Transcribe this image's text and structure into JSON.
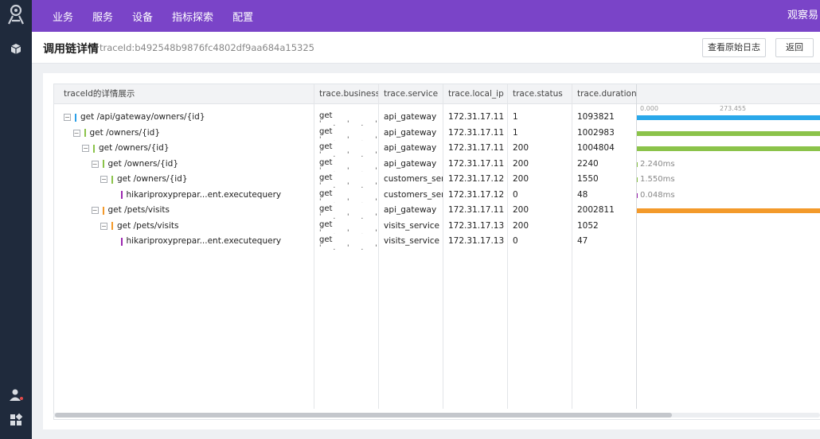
{
  "topnav": {
    "menu": [
      "业务",
      "服务",
      "设备",
      "指标探索",
      "配置"
    ],
    "brand": "观察易"
  },
  "header": {
    "title": "调用链详情",
    "trace_id_text": "traceId:b492548b9876fc4802df9aa684a15325",
    "buttons": {
      "raw_log": "查看原始日志",
      "back": "返回"
    }
  },
  "table": {
    "columns": [
      "traceId的详情展示",
      "trace.business",
      "trace.service",
      "trace.local_ip",
      "trace.status",
      "trace.duration"
    ],
    "timeline_ticks": [
      "0.000",
      "273.455"
    ],
    "rows": [
      {
        "depth": 0,
        "toggle": "−",
        "color": "#2a9fe8",
        "operation": "get /api/gateway/owners/{id}",
        "business": "get",
        "service": "api_gateway",
        "ip": "172.31.17.11",
        "status": "1",
        "duration": "1093821",
        "bar_start": 0.0,
        "bar_fill": 1.0,
        "bar_color": "#2aa8ea",
        "bar_label": ""
      },
      {
        "depth": 1,
        "toggle": "−",
        "color": "#8bc34a",
        "operation": "get /owners/{id}",
        "business": "get",
        "service": "api_gateway",
        "ip": "172.31.17.11",
        "status": "1",
        "duration": "1002983",
        "bar_start": 0.0,
        "bar_fill": 1.0,
        "bar_color": "#8bc34a",
        "bar_label": ""
      },
      {
        "depth": 2,
        "toggle": "−",
        "color": "#8bc34a",
        "operation": "get /owners/{id}",
        "business": "get",
        "service": "api_gateway",
        "ip": "172.31.17.11",
        "status": "200",
        "duration": "1004804",
        "bar_start": 0.0,
        "bar_fill": 1.0,
        "bar_color": "#8bc34a",
        "bar_label": ""
      },
      {
        "depth": 3,
        "toggle": "−",
        "color": "#8bc34a",
        "operation": "get /owners/{id}",
        "business": "get",
        "service": "api_gateway",
        "ip": "172.31.17.11",
        "status": "200",
        "duration": "2240",
        "bar_start": 0.0,
        "bar_fill": 0.0,
        "bar_color": "#8bc34a",
        "bar_label": "2.240ms"
      },
      {
        "depth": 4,
        "toggle": "−",
        "color": "#8bc34a",
        "operation": "get /owners/{id}",
        "business": "get",
        "service": "customers_service",
        "ip": "172.31.17.12",
        "status": "200",
        "duration": "1550",
        "bar_start": 0.0,
        "bar_fill": 0.0,
        "bar_color": "#8bc34a",
        "bar_label": "1.550ms"
      },
      {
        "depth": 5,
        "toggle": "",
        "color": "#9c27b0",
        "operation": "hikariproxyprepar...ent.executequery",
        "business": "get",
        "service": "customers_service",
        "ip": "172.31.17.12",
        "status": "0",
        "duration": "48",
        "bar_start": 0.0,
        "bar_fill": 0.0,
        "bar_color": "#9c27b0",
        "bar_label": "0.048ms"
      },
      {
        "depth": 3,
        "toggle": "−",
        "color": "#f39a2b",
        "operation": "get /pets/visits",
        "business": "get",
        "service": "api_gateway",
        "ip": "172.31.17.11",
        "status": "200",
        "duration": "2002811",
        "bar_start": 0.0,
        "bar_fill": 1.0,
        "bar_color": "#f39a2b",
        "bar_label": ""
      },
      {
        "depth": 4,
        "toggle": "−",
        "color": "#f39a2b",
        "operation": "get /pets/visits",
        "business": "get",
        "service": "visits_service",
        "ip": "172.31.17.13",
        "status": "200",
        "duration": "1052",
        "bar_start": 0.0,
        "bar_fill": 0.0,
        "bar_color": "#f39a2b",
        "bar_label": ""
      },
      {
        "depth": 5,
        "toggle": "",
        "color": "#9c27b0",
        "operation": "hikariproxyprepar...ent.executequery",
        "business": "get",
        "service": "visits_service",
        "ip": "172.31.17.13",
        "status": "0",
        "duration": "47",
        "bar_start": 0.0,
        "bar_fill": 0.0,
        "bar_color": "#9c27b0",
        "bar_label": ""
      }
    ]
  }
}
